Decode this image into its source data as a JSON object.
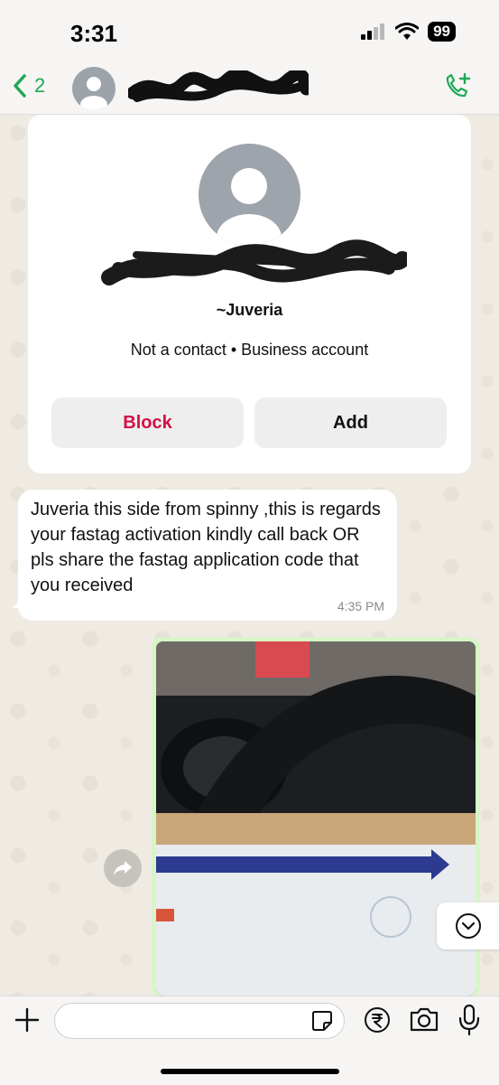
{
  "status_bar": {
    "time": "3:31",
    "battery": "99"
  },
  "header": {
    "back_count": "2"
  },
  "contact_card": {
    "display_name": "~Juveria",
    "subtitle": "Not a contact • Business account",
    "block_label": "Block",
    "add_label": "Add"
  },
  "message": {
    "text": "Juveria this side from spinny ,this is regards your fastag  activation  kindly call back OR pls share the fastag application code that you received",
    "time": "4:35 PM"
  },
  "composer": {
    "placeholder": ""
  },
  "colors": {
    "accent": "#1fa855",
    "block": "#d40f45",
    "chat_bg": "#efeae2",
    "image_border": "#d8f5c8"
  },
  "icons": [
    "signal-icon",
    "wifi-icon",
    "battery-icon",
    "back-chevron-icon",
    "avatar-icon",
    "call-add-icon",
    "forward-icon",
    "chevron-down-icon",
    "plus-icon",
    "sticker-icon",
    "rupee-icon",
    "camera-icon",
    "mic-icon"
  ]
}
